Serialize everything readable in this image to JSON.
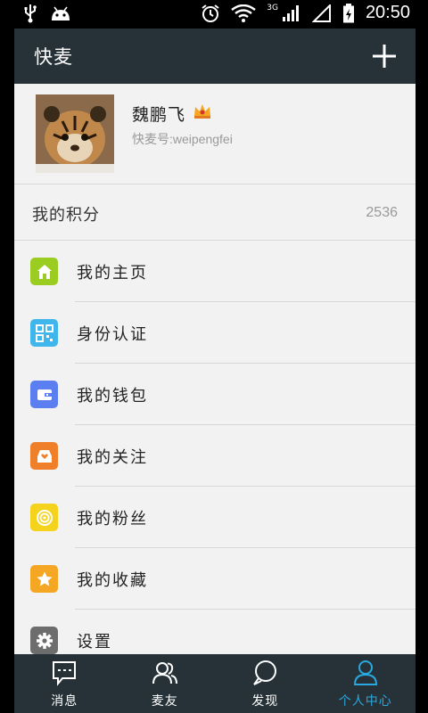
{
  "status_bar": {
    "time": "20:50",
    "network": "3G"
  },
  "header": {
    "title": "快麦"
  },
  "profile": {
    "name": "魏鹏飞",
    "account": "快麦号:weipengfei"
  },
  "points": {
    "label": "我的积分",
    "value": "2536"
  },
  "menu": [
    {
      "label": "我的主页",
      "icon": "home-icon",
      "color": "#9bcc22"
    },
    {
      "label": "身份认证",
      "icon": "qr-code-icon",
      "color": "#3fb6ec"
    },
    {
      "label": "我的钱包",
      "icon": "wallet-icon",
      "color": "#5b7ef0"
    },
    {
      "label": "我的关注",
      "icon": "inbox-heart-icon",
      "color": "#f07f2a"
    },
    {
      "label": "我的粉丝",
      "icon": "broadcast-icon",
      "color": "#f5d21c"
    },
    {
      "label": "我的收藏",
      "icon": "star-icon",
      "color": "#f5a623"
    },
    {
      "label": "设置",
      "icon": "gear-icon",
      "color": "#6d6d6d"
    }
  ],
  "tabs": [
    {
      "label": "消息",
      "icon": "chat-icon"
    },
    {
      "label": "麦友",
      "icon": "contacts-icon"
    },
    {
      "label": "发现",
      "icon": "discover-icon"
    },
    {
      "label": "个人中心",
      "icon": "person-icon",
      "active": true
    }
  ],
  "colors": {
    "header_bg": "#263238",
    "active_tab": "#2aa8e0",
    "page_bg": "#f2f2f2"
  }
}
